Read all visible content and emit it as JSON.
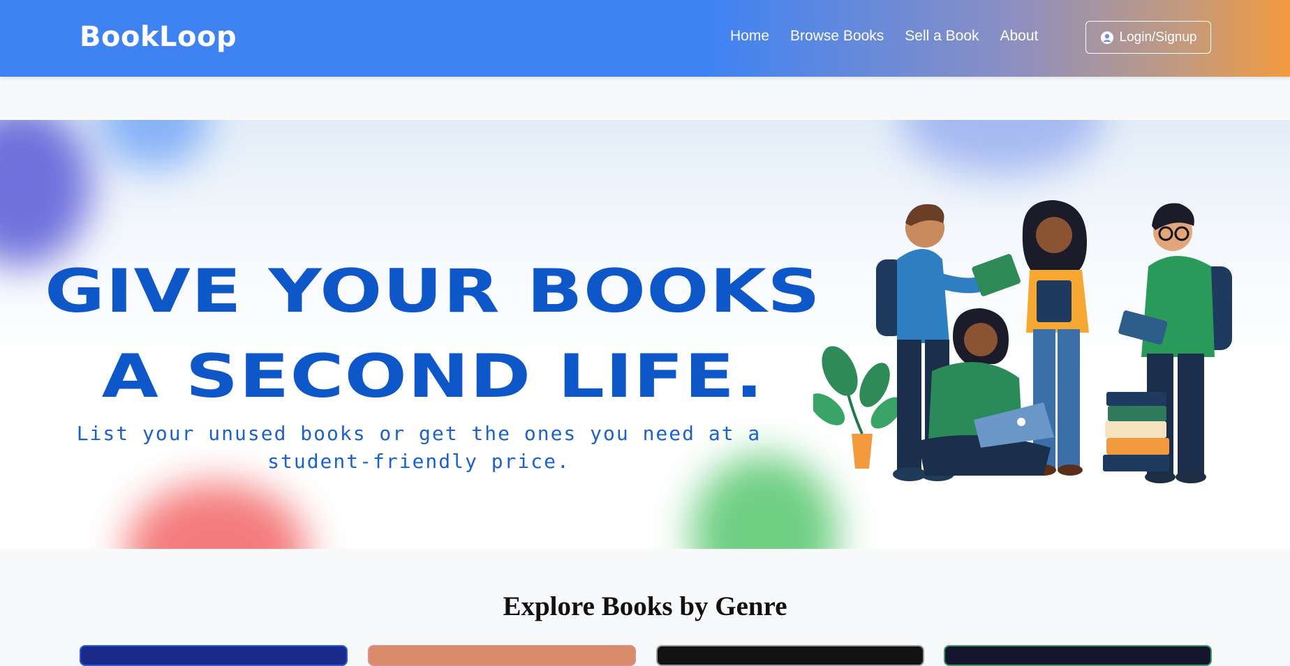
{
  "navbar": {
    "brand": "BookLoop",
    "links": [
      "Home",
      "Browse Books",
      "Sell a Book",
      "About"
    ],
    "login_label": "Login/Signup",
    "gradient_start": "#3f83f3",
    "gradient_end": "#f39a3f"
  },
  "hero": {
    "title_line1": "GIVE YOUR BOOKS",
    "title_line2": "A SECOND LIFE.",
    "subtitle_line1": "List your unused books or get the ones you need at a",
    "subtitle_line2": "student-friendly price.",
    "title_color": "#0d57c9"
  },
  "genres": {
    "heading": "Explore Books by Genre",
    "cards": [
      {
        "border": "#2a5bd6",
        "fill": "#1c2a8a"
      },
      {
        "border": "#e08a8a",
        "fill": "#d98b6a"
      },
      {
        "border": "#999999",
        "fill": "#111111"
      },
      {
        "border": "#3a9a6a",
        "fill": "#161530"
      }
    ]
  },
  "icons": {
    "login": "user-circle-icon"
  }
}
